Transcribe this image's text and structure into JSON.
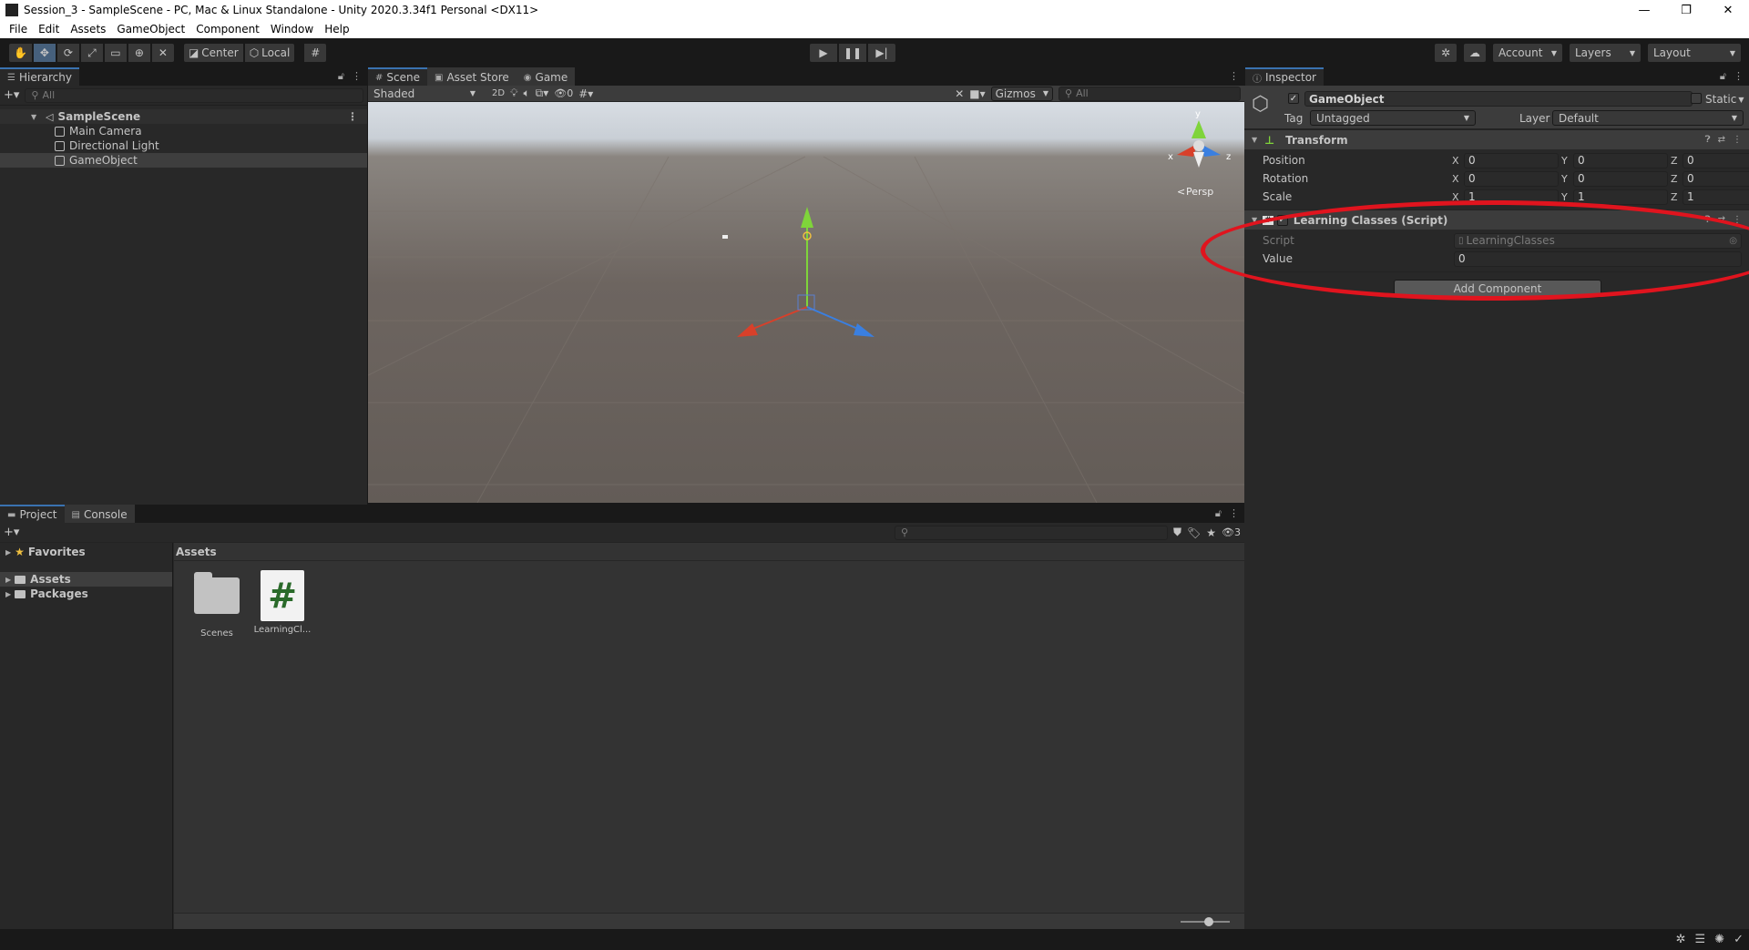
{
  "window": {
    "title": "Session_3 - SampleScene - PC, Mac & Linux Standalone - Unity 2020.3.34f1 Personal <DX11>",
    "minimize": "—",
    "restore": "❐",
    "close": "✕"
  },
  "menu": [
    "File",
    "Edit",
    "Assets",
    "GameObject",
    "Component",
    "Window",
    "Help"
  ],
  "toolbar": {
    "pivot_label": "Center",
    "space_label": "Local",
    "account_label": "Account",
    "layers_label": "Layers",
    "layout_label": "Layout"
  },
  "hierarchy": {
    "tab_label": "Hierarchy",
    "search_placeholder": "All",
    "add_label": "+▾",
    "scene_name": "SampleScene",
    "items": [
      "Main Camera",
      "Directional Light",
      "GameObject"
    ]
  },
  "scene_view": {
    "tabs": [
      "Scene",
      "Asset Store",
      "Game"
    ],
    "shading_mode": "Shaded",
    "mode_2d": "2D",
    "hidden_count": "0",
    "gizmos_label": "Gizmos",
    "search_placeholder": "All",
    "persp_label": "Persp",
    "axis_x": "x",
    "axis_z": "z",
    "axis_y": "y"
  },
  "inspector": {
    "tab_label": "Inspector",
    "object_name": "GameObject",
    "static_label": "Static",
    "tag_label": "Tag",
    "tag_value": "Untagged",
    "layer_label": "Layer",
    "layer_value": "Default",
    "transform": {
      "title": "Transform",
      "position_label": "Position",
      "rotation_label": "Rotation",
      "scale_label": "Scale",
      "position": [
        "0",
        "0",
        "0"
      ],
      "rotation": [
        "0",
        "0",
        "0"
      ],
      "scale": [
        "1",
        "1",
        "1"
      ]
    },
    "script_component": {
      "title": "Learning Classes (Script)",
      "script_label": "Script",
      "script_value": "LearningClasses",
      "value_label": "Value",
      "value": "0"
    },
    "add_component_label": "Add Component"
  },
  "project": {
    "tabs": [
      "Project",
      "Console"
    ],
    "add_label": "+▾",
    "hidden_count": "3",
    "favorites_label": "Favorites",
    "tree": [
      "Assets",
      "Packages"
    ],
    "breadcrumb": "Assets",
    "assets": [
      {
        "name": "Scenes",
        "type": "folder"
      },
      {
        "name": "LearningCl...",
        "type": "script"
      }
    ]
  },
  "colors": {
    "accent": "#3a72b0",
    "annotation": "#e0141e",
    "axis_x": "#d8402a",
    "axis_y": "#7fd43a",
    "axis_z": "#3a7fe0"
  }
}
